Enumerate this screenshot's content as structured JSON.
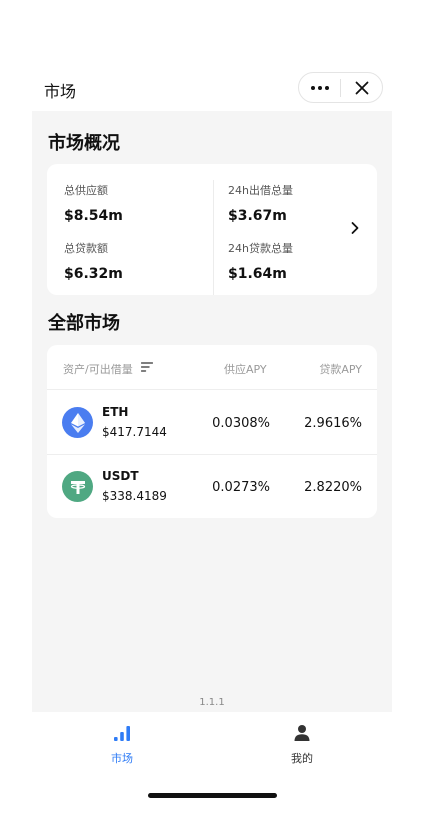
{
  "header": {
    "title": "市场",
    "more_icon": "more-dots-icon",
    "close_icon": "close-icon"
  },
  "overview": {
    "title": "市场概况",
    "total_supply_label": "总供应额",
    "total_supply_value": "$8.54m",
    "total_borrow_label": "总贷款额",
    "total_borrow_value": "$6.32m",
    "supply_24h_label": "24h出借总量",
    "supply_24h_value": "$3.67m",
    "borrow_24h_label": "24h贷款总量",
    "borrow_24h_value": "$1.64m"
  },
  "markets": {
    "title": "全部市场",
    "columns": {
      "asset": "资产/可出借量",
      "supply_apy": "供应APY",
      "borrow_apy": "贷款APY"
    },
    "rows": [
      {
        "symbol": "ETH",
        "amount": "$417.7144",
        "supply_apy": "0.0308%",
        "borrow_apy": "2.9616%",
        "icon": "ethereum-icon",
        "color": "#4a7df0"
      },
      {
        "symbol": "USDT",
        "amount": "$338.4189",
        "supply_apy": "0.0273%",
        "borrow_apy": "2.8220%",
        "icon": "tether-icon",
        "color": "#4fa882"
      }
    ]
  },
  "version": "1.1.1",
  "tabbar": {
    "items": [
      {
        "label": "市场",
        "icon": "bar-chart-icon",
        "active": true
      },
      {
        "label": "我的",
        "icon": "user-icon",
        "active": false
      }
    ]
  },
  "colors": {
    "accent": "#2f7cf6",
    "background": "#f5f5f5"
  }
}
